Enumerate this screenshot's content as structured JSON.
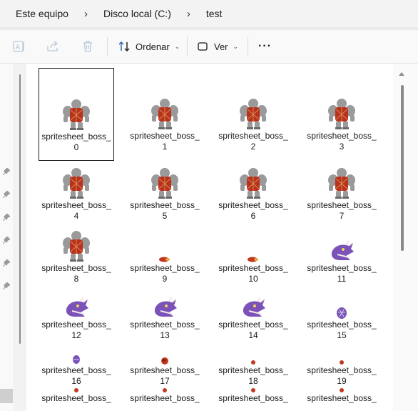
{
  "breadcrumb": {
    "items": [
      "Este equipo",
      "Disco local (C:)",
      "test"
    ]
  },
  "toolbar": {
    "sort_label": "Ordenar",
    "view_label": "Ver",
    "more_label": "···"
  },
  "files": [
    {
      "line1": "spritesheet_boss_",
      "line2": "0",
      "thumb": "ogre",
      "selected": true
    },
    {
      "line1": "spritesheet_boss_",
      "line2": "1",
      "thumb": "ogre"
    },
    {
      "line1": "spritesheet_boss_",
      "line2": "2",
      "thumb": "ogre"
    },
    {
      "line1": "spritesheet_boss_",
      "line2": "3",
      "thumb": "ogre"
    },
    {
      "line1": "spritesheet_boss_",
      "line2": "4",
      "thumb": "ogre"
    },
    {
      "line1": "spritesheet_boss_",
      "line2": "5",
      "thumb": "ogre"
    },
    {
      "line1": "spritesheet_boss_",
      "line2": "6",
      "thumb": "ogre"
    },
    {
      "line1": "spritesheet_boss_",
      "line2": "7",
      "thumb": "ogre"
    },
    {
      "line1": "spritesheet_boss_",
      "line2": "8",
      "thumb": "ogre"
    },
    {
      "line1": "spritesheet_boss_",
      "line2": "9",
      "thumb": "fireball-small"
    },
    {
      "line1": "spritesheet_boss_",
      "line2": "10",
      "thumb": "fireball-small"
    },
    {
      "line1": "spritesheet_boss_",
      "line2": "11",
      "thumb": "dragon-head"
    },
    {
      "line1": "spritesheet_boss_",
      "line2": "12",
      "thumb": "dragon-head"
    },
    {
      "line1": "spritesheet_boss_",
      "line2": "13",
      "thumb": "dragon-head"
    },
    {
      "line1": "spritesheet_boss_",
      "line2": "14",
      "thumb": "dragon-head"
    },
    {
      "line1": "spritesheet_boss_",
      "line2": "15",
      "thumb": "purple-orb"
    },
    {
      "line1": "spritesheet_boss_",
      "line2": "16",
      "thumb": "purple-orb-small"
    },
    {
      "line1": "spritesheet_boss_",
      "line2": "17",
      "thumb": "red-orb"
    },
    {
      "line1": "spritesheet_boss_",
      "line2": "18",
      "thumb": "red-dot"
    },
    {
      "line1": "spritesheet_boss_",
      "line2": "19",
      "thumb": "red-dot"
    },
    {
      "line1": "spritesheet_boss_",
      "line2": "",
      "thumb": "red-dot"
    },
    {
      "line1": "spritesheet_boss_",
      "line2": "",
      "thumb": "red-dot"
    },
    {
      "line1": "spritesheet_boss_",
      "line2": "",
      "thumb": "red-dot"
    },
    {
      "line1": "spritesheet_boss_",
      "line2": "",
      "thumb": "red-dot"
    }
  ],
  "colors": {
    "ogre_body": "#9a9a9a",
    "ogre_vest": "#b8321e",
    "dragon": "#7a52b8",
    "fire": "#c0391f"
  }
}
